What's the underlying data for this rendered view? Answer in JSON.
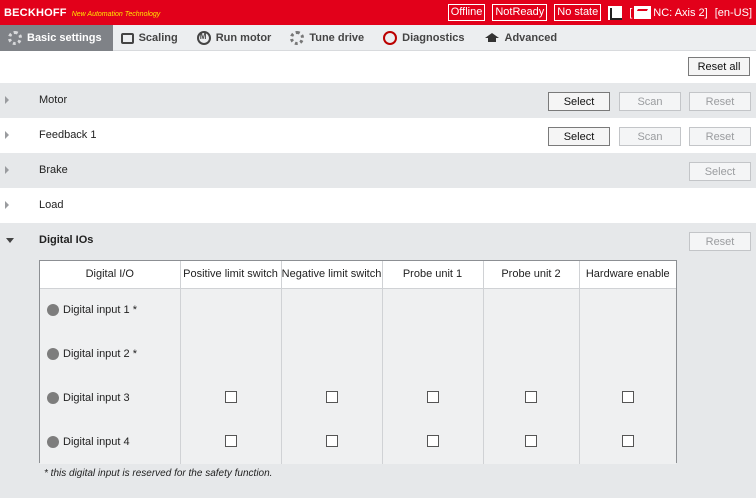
{
  "header": {
    "brand": "BECKHOFF",
    "tagline": "New Automation Technology",
    "status": [
      "Offline",
      "NotReady",
      "No state"
    ],
    "axis_bracket": "[",
    "axis_label": "NC: Axis 2]",
    "language": "[en-US]"
  },
  "tabs": [
    {
      "label": "Basic settings",
      "icon": "gear-icon",
      "active": true
    },
    {
      "label": "Scaling",
      "icon": "scaling-icon",
      "active": false
    },
    {
      "label": "Run motor",
      "icon": "motor-icon",
      "active": false
    },
    {
      "label": "Tune drive",
      "icon": "gears-icon",
      "active": false
    },
    {
      "label": "Diagnostics",
      "icon": "diagnostics-icon",
      "active": false
    },
    {
      "label": "Advanced",
      "icon": "graduation-cap-icon",
      "active": false
    }
  ],
  "toolbar": {
    "reset_all": "Reset all"
  },
  "sections": {
    "motor": {
      "label": "Motor",
      "select": "Select",
      "scan": "Scan",
      "reset": "Reset"
    },
    "feedback": {
      "label": "Feedback 1",
      "select": "Select",
      "scan": "Scan",
      "reset": "Reset"
    },
    "brake": {
      "label": "Brake",
      "select": "Select"
    },
    "load": {
      "label": "Load"
    },
    "digital_ios": {
      "label": "Digital IOs",
      "reset": "Reset"
    }
  },
  "io_table": {
    "columns": [
      "Digital I/O",
      "Positive limit switch",
      "Negative limit switch",
      "Probe unit 1",
      "Probe unit 2",
      "Hardware enable"
    ],
    "rows": [
      {
        "name": "Digital input 1 *",
        "checkboxes": false
      },
      {
        "name": "Digital input 2 *",
        "checkboxes": false
      },
      {
        "name": "Digital input 3",
        "checkboxes": true
      },
      {
        "name": "Digital input 4",
        "checkboxes": true
      }
    ],
    "footnote": "* this digital input is reserved for the safety function."
  }
}
